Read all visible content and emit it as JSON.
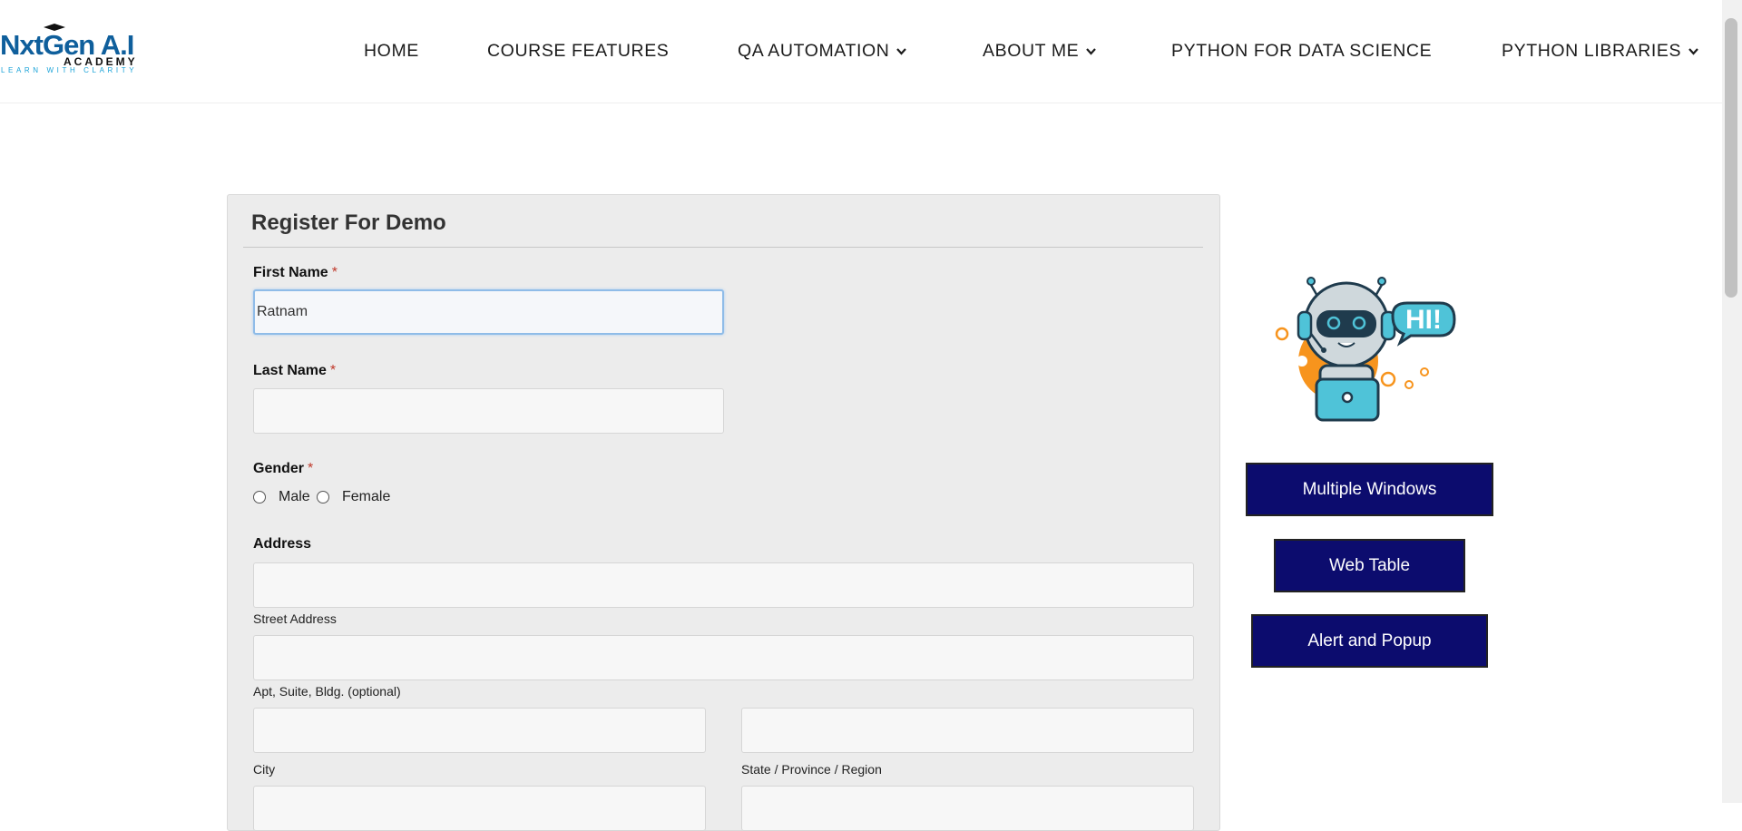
{
  "logo": {
    "brand": "NxtGen A.I",
    "academy": "ACADEMY",
    "tagline": "LEARN WITH CLARITY"
  },
  "nav": {
    "home": "HOME",
    "course_features": "COURSE FEATURES",
    "qa_automation": "QA AUTOMATION",
    "about_me": "ABOUT ME",
    "python_ds": "PYTHON FOR DATA SCIENCE",
    "python_libs": "PYTHON LIBRARIES"
  },
  "form": {
    "title": "Register For Demo",
    "first_name_label": "First Name",
    "first_name_value": "Ratnam",
    "last_name_label": "Last Name",
    "last_name_value": "",
    "required_mark": "*",
    "gender_label": "Gender",
    "gender_options": [
      "Male",
      "Female"
    ],
    "address_label": "Address",
    "street_caption": "Street Address",
    "apt_caption": "Apt, Suite, Bldg. (optional)",
    "city_caption": "City",
    "state_caption": "State / Province / Region"
  },
  "robot": {
    "bubble_text": "HI!"
  },
  "side_buttons": {
    "multiple_windows": "Multiple Windows",
    "web_table": "Web Table",
    "alert_popup": "Alert and Popup"
  },
  "colors": {
    "button_bg": "#0c0c6e",
    "brand_blue": "#0f5f9c",
    "accent_teal": "#4fc3d8",
    "accent_orange": "#f7941d"
  }
}
